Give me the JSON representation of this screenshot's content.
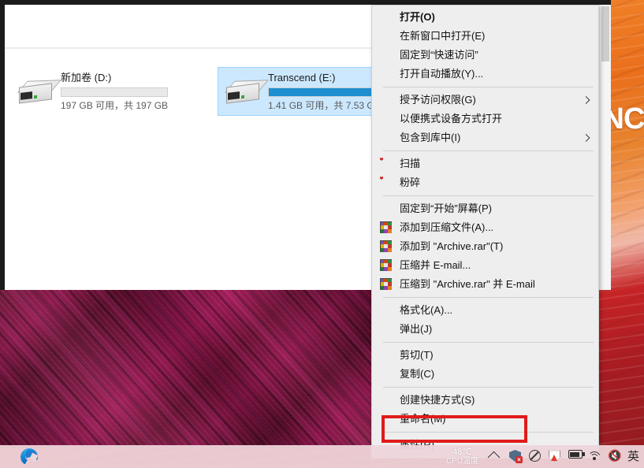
{
  "desktop": {
    "wallpaper_word": "INCR",
    "wallpaper_accent": "#ef7f27",
    "wallpaper_secondary": "#8c1247"
  },
  "explorer": {
    "drives": [
      {
        "name": "新加卷 (D:)",
        "capacity_text": "197 GB 可用，共 197 GB",
        "used_percent": 0,
        "selected": false,
        "icon": "external-drive-icon"
      },
      {
        "name": "Transcend (E:)",
        "capacity_text": "1.41 GB 可用，共 7.53 G",
        "used_percent": 100,
        "selected": true,
        "icon": "external-drive-icon"
      }
    ],
    "selection_color": "#cce8ff",
    "bar_fill_color": "#1d8fd1"
  },
  "context_menu": {
    "highlight_color": "#e01b1b",
    "highlighted_item": "属性(R)",
    "groups": [
      {
        "items": [
          {
            "label": "打开(O)",
            "bold": true,
            "icon": null,
            "submenu": false
          },
          {
            "label": "在新窗口中打开(E)",
            "bold": false,
            "icon": null,
            "submenu": false
          },
          {
            "label": "固定到“快速访问”",
            "bold": false,
            "icon": null,
            "submenu": false
          },
          {
            "label": "打开自动播放(Y)...",
            "bold": false,
            "icon": null,
            "submenu": false
          }
        ]
      },
      {
        "items": [
          {
            "label": "授予访问权限(G)",
            "bold": false,
            "icon": null,
            "submenu": true
          },
          {
            "label": "以便携式设备方式打开",
            "bold": false,
            "icon": null,
            "submenu": false
          },
          {
            "label": "包含到库中(I)",
            "bold": false,
            "icon": null,
            "submenu": true
          }
        ]
      },
      {
        "items": [
          {
            "label": "扫描",
            "bold": false,
            "icon": "red-shield-icon",
            "submenu": false
          },
          {
            "label": "粉碎",
            "bold": false,
            "icon": "red-shield-icon",
            "submenu": false
          }
        ]
      },
      {
        "items": [
          {
            "label": "固定到“开始”屏幕(P)",
            "bold": false,
            "icon": null,
            "submenu": false
          },
          {
            "label": "添加到压缩文件(A)...",
            "bold": false,
            "icon": "winrar-icon",
            "submenu": false
          },
          {
            "label": "添加到 \"Archive.rar\"(T)",
            "bold": false,
            "icon": "winrar-icon",
            "submenu": false
          },
          {
            "label": "压缩并 E-mail...",
            "bold": false,
            "icon": "winrar-icon",
            "submenu": false
          },
          {
            "label": "压缩到 \"Archive.rar\" 并 E-mail",
            "bold": false,
            "icon": "winrar-icon",
            "submenu": false
          }
        ]
      },
      {
        "items": [
          {
            "label": "格式化(A)...",
            "bold": false,
            "icon": null,
            "submenu": false
          },
          {
            "label": "弹出(J)",
            "bold": false,
            "icon": null,
            "submenu": false
          }
        ]
      },
      {
        "items": [
          {
            "label": "剪切(T)",
            "bold": false,
            "icon": null,
            "submenu": false
          },
          {
            "label": "复制(C)",
            "bold": false,
            "icon": null,
            "submenu": false
          }
        ]
      },
      {
        "items": [
          {
            "label": "创建快捷方式(S)",
            "bold": false,
            "icon": null,
            "submenu": false
          },
          {
            "label": "重命名(M)",
            "bold": false,
            "icon": null,
            "submenu": false
          }
        ]
      },
      {
        "items": [
          {
            "label": "属性(R)",
            "bold": false,
            "icon": null,
            "submenu": false,
            "highlighted": true
          }
        ]
      }
    ]
  },
  "taskbar": {
    "apps": [
      {
        "name": "edge-icon",
        "label": "Microsoft Edge"
      }
    ],
    "cpu_temp": "48℃",
    "cpu_temp_label": "CPU温度",
    "tray": [
      {
        "name": "show-hidden-icons-chevron",
        "glyph": "chevron-up"
      },
      {
        "name": "security-shield-error-icon",
        "glyph": "shield-x"
      },
      {
        "name": "disabled-network-icon",
        "glyph": "no-sign"
      },
      {
        "name": "antivirus-warning-shield-icon",
        "glyph": "shield-warn"
      },
      {
        "name": "battery-icon",
        "glyph": "battery"
      },
      {
        "name": "wifi-icon",
        "glyph": "wifi"
      },
      {
        "name": "volume-muted-icon",
        "glyph": "speaker-mute"
      },
      {
        "name": "ime-language-indicator",
        "glyph": "英"
      }
    ],
    "ime": "英"
  }
}
